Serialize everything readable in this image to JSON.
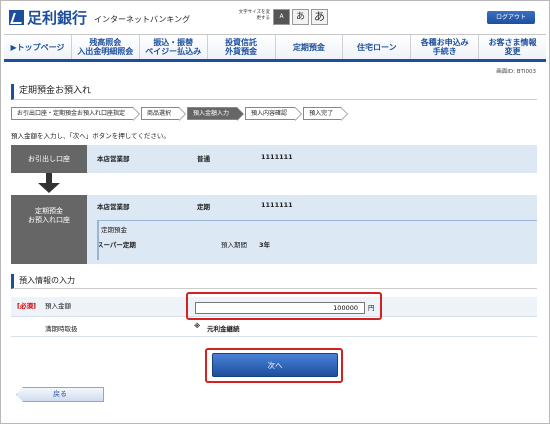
{
  "header": {
    "logo_text": "足利銀行",
    "logo_sub": "インターネットバンキング",
    "fontsize_label": "文字サイズを変更する",
    "size_options": [
      "A",
      "あ",
      "あ"
    ],
    "logout_label": "ログアウト"
  },
  "gnav": {
    "items": [
      "▶トップページ",
      "残高照会\n入出金明細照会",
      "振込・振替\nペイジー払込み",
      "投資信託\n外貨預金",
      "定期預金",
      "住宅ローン",
      "各種お申込み\n手続き",
      "お客さま情報\n変更"
    ]
  },
  "screen_id": "画面ID: BTI003",
  "page_title": "定期預金お預入れ",
  "steps": [
    "お引出口座・定期預金お預入れ口座指定",
    "商品選択",
    "預入金額入力",
    "預入内容確認",
    "預入完了"
  ],
  "active_step": 2,
  "instruction": "預入金額を入力し、「次へ」ボタンを押してください。",
  "from_account": {
    "label": "お引出し口座",
    "branch": "本店営業部",
    "type": "普通",
    "number": "1111111"
  },
  "to_account": {
    "label": "定期預金\nお預入れ口座",
    "branch": "本店営業部",
    "type": "定期",
    "number": "1111111",
    "deposit_kind": "定期預金",
    "product": "スーパー定期",
    "period_label": "預入期間",
    "period_value": "3年"
  },
  "section_title": "預入情報の入力",
  "form": {
    "required_tag": "[必須]",
    "amount_label": "預入金額",
    "amount_value": "100000",
    "currency": "円",
    "maturity_label": "満期時取扱",
    "maturity_prefix": "※",
    "maturity_value": "元利金継続"
  },
  "buttons": {
    "next": "次へ",
    "back": "戻る"
  },
  "colors": {
    "brand": "#1d4f9c",
    "label_bg": "#666666",
    "value_bg": "#dde8f5",
    "highlight": "#d32020"
  }
}
